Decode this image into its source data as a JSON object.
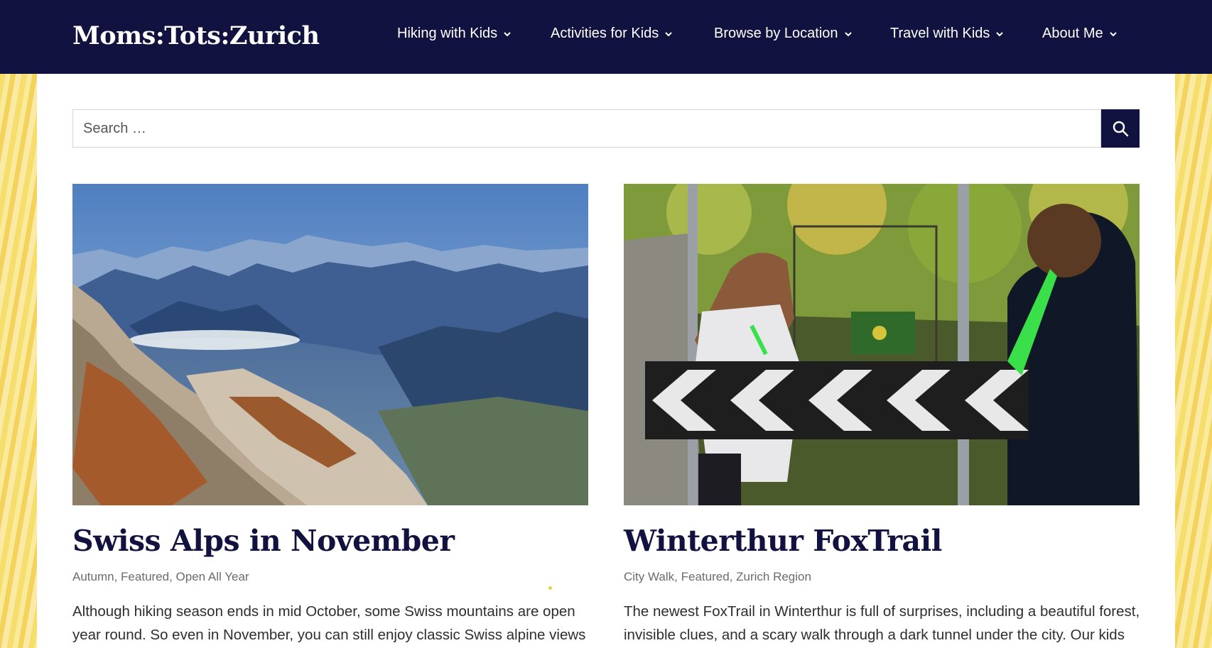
{
  "site": {
    "title": "Moms:Tots:Zurich"
  },
  "nav": {
    "items": [
      {
        "label": "Hiking with Kids"
      },
      {
        "label": "Activities for Kids"
      },
      {
        "label": "Browse by Location"
      },
      {
        "label": "Travel with Kids"
      },
      {
        "label": "About Me"
      }
    ]
  },
  "search": {
    "placeholder": "Search …"
  },
  "posts": [
    {
      "title": "Swiss Alps in November",
      "categories": [
        "Autumn",
        "Featured",
        "Open All Year"
      ],
      "excerpt": [
        "Although hiking season ends in mid October, some Swiss mountains are open",
        "year round. So even in November, you can still enjoy classic Swiss alpine views"
      ]
    },
    {
      "title": "Winterthur FoxTrail",
      "categories": [
        "City Walk",
        "Featured",
        "Zurich Region"
      ],
      "excerpt": [
        "The newest FoxTrail in Winterthur is full of surprises, including a beautiful forest,",
        "invisible clues, and a scary walk through a dark tunnel under the city. Our kids"
      ]
    }
  ],
  "icons": {
    "search": "search-icon",
    "chevron": "chevron-down-icon"
  },
  "colors": {
    "header": "#11123f",
    "title": "#11123f",
    "background": "#f7df78"
  }
}
